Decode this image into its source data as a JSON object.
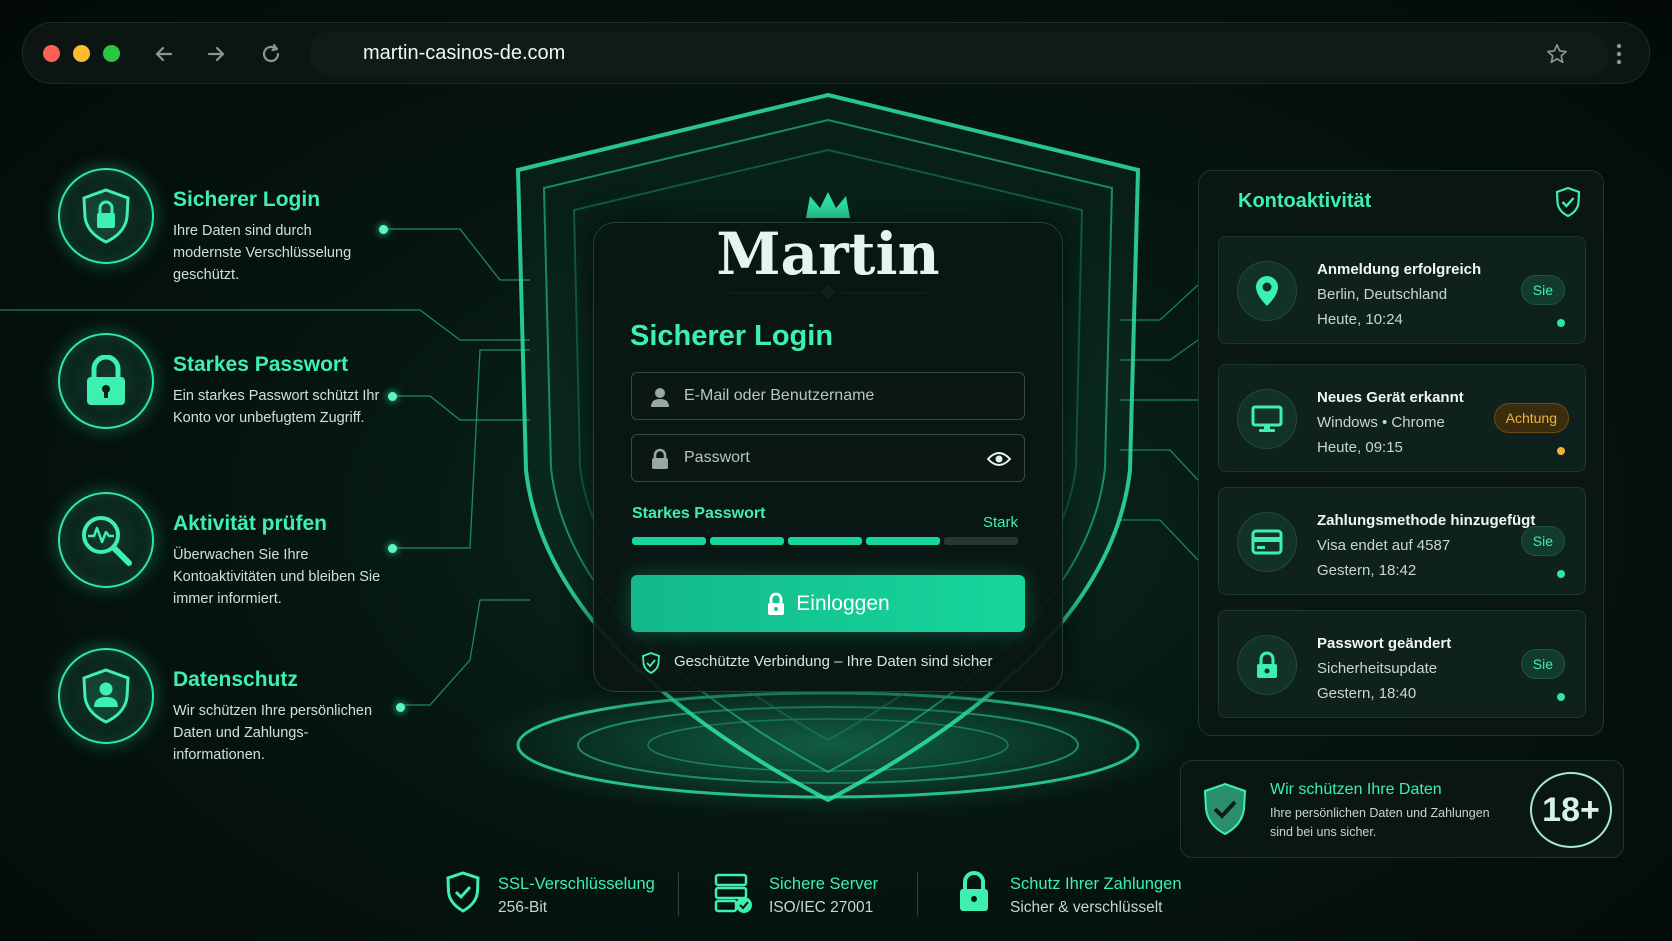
{
  "browser": {
    "url": "martin-casinos-de.com",
    "traffic_lights": [
      "#ff5f57",
      "#febc2e",
      "#28c840"
    ],
    "nav_icons": [
      "back-arrow-icon",
      "forward-arrow-icon",
      "reload-icon"
    ],
    "right_icons": [
      "star-icon",
      "more-vertical-icon"
    ]
  },
  "colors": {
    "accent": "#3df0b0",
    "button": "#17d69c",
    "warning": "#f0b43a",
    "background": "#061612"
  },
  "features": [
    {
      "icon": "shield-lock-icon",
      "title": "Sicherer Login",
      "desc": "Ihre Daten sind durch modernste Verschlüsselung geschützt."
    },
    {
      "icon": "padlock-icon",
      "title": "Starkes Passwort",
      "desc": "Ein starkes Passwort schützt Ihr Konto vor unbefugtem Zugriff."
    },
    {
      "icon": "magnifier-activity-icon",
      "title": "Aktivität prüfen",
      "desc": "Überwachen Sie Ihre Kontoaktivitäten und bleiben Sie immer informiert."
    },
    {
      "icon": "shield-user-icon",
      "title": "Datenschutz",
      "desc": "Wir schützen Ihre persönlichen Daten und Zahlungs-informationen."
    }
  ],
  "login": {
    "brand": "Martin",
    "title": "Sicherer Login",
    "username_placeholder": "E-Mail oder Benutzername",
    "password_placeholder": "Passwort",
    "strength_label": "Starkes Passwort",
    "strength_value": "Stark",
    "strength_level": 0.8,
    "button_label": "Einloggen",
    "secure_note": "Geschützte Verbindung – Ihre Daten sind sicher"
  },
  "activity": {
    "title": "Kontoaktivität",
    "items": [
      {
        "icon": "location-pin-icon",
        "title": "Anmeldung erfolgreich",
        "line2": "Berlin, Deutschland",
        "line3": "Heute, 10:24",
        "badge": "Sie",
        "status": "ok"
      },
      {
        "icon": "monitor-icon",
        "title": "Neues Gerät erkannt",
        "line2": "Windows • Chrome",
        "line3": "Heute, 09:15",
        "badge": "Achtung",
        "status": "warning"
      },
      {
        "icon": "credit-card-icon",
        "title": "Zahlungsmethode hinzugefügt",
        "line2": "Visa endet auf 4587",
        "line3": "Gestern, 18:42",
        "badge": "Sie",
        "status": "ok"
      },
      {
        "icon": "padlock-icon",
        "title": "Passwort geändert",
        "line2": "Sicherheitsupdate",
        "line3": "Gestern, 18:40",
        "badge": "Sie",
        "status": "ok"
      }
    ]
  },
  "protect": {
    "title": "Wir schützen Ihre Daten",
    "desc": "Ihre persönlichen Daten und Zahlungen sind bei uns sicher.",
    "age": "18+"
  },
  "trust": [
    {
      "icon": "shield-check-icon",
      "title": "SSL-Verschlüsselung",
      "sub": "256-Bit"
    },
    {
      "icon": "server-check-icon",
      "title": "Sichere Server",
      "sub": "ISO/IEC 27001"
    },
    {
      "icon": "padlock-icon",
      "title": "Schutz Ihrer Zahlungen",
      "sub": "Sicher & verschlüsselt"
    }
  ]
}
